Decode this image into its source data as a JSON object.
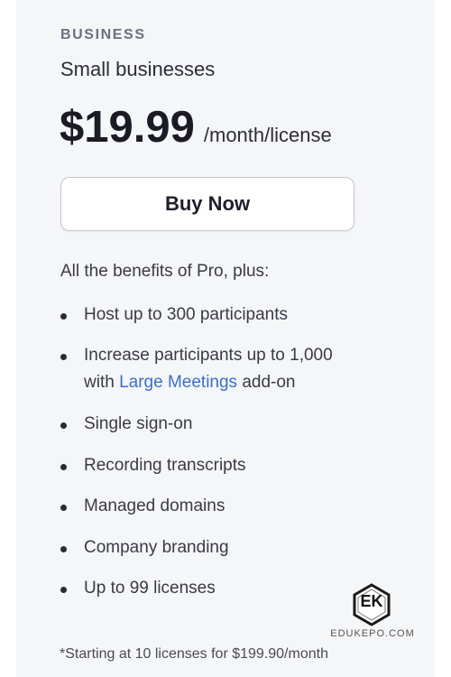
{
  "plan": {
    "tier_label": "BUSINESS",
    "subtitle": "Small businesses",
    "price": "$19.99",
    "price_unit": "/month/license",
    "buy_button_label": "Buy Now"
  },
  "benefits": {
    "intro": "All the benefits of Pro, plus:",
    "items": [
      {
        "text": "Host up to 300 participants"
      },
      {
        "line1": "Increase participants up to 1,000",
        "line2_prefix": "with ",
        "link_text": "Large Meetings",
        "line2_suffix": " add-on"
      },
      {
        "text": "Single sign-on"
      },
      {
        "text": "Recording transcripts"
      },
      {
        "text": "Managed domains"
      },
      {
        "text": "Company branding"
      },
      {
        "text": "Up to 99 licenses"
      }
    ]
  },
  "footnote": "*Starting at 10 licenses for $199.90/month",
  "watermark": {
    "logo_letters": "EK",
    "site": "EDUKEPO.COM"
  },
  "colors": {
    "card_background": "#f5f6f8",
    "link": "#3b6fc9",
    "text": "#232333"
  }
}
